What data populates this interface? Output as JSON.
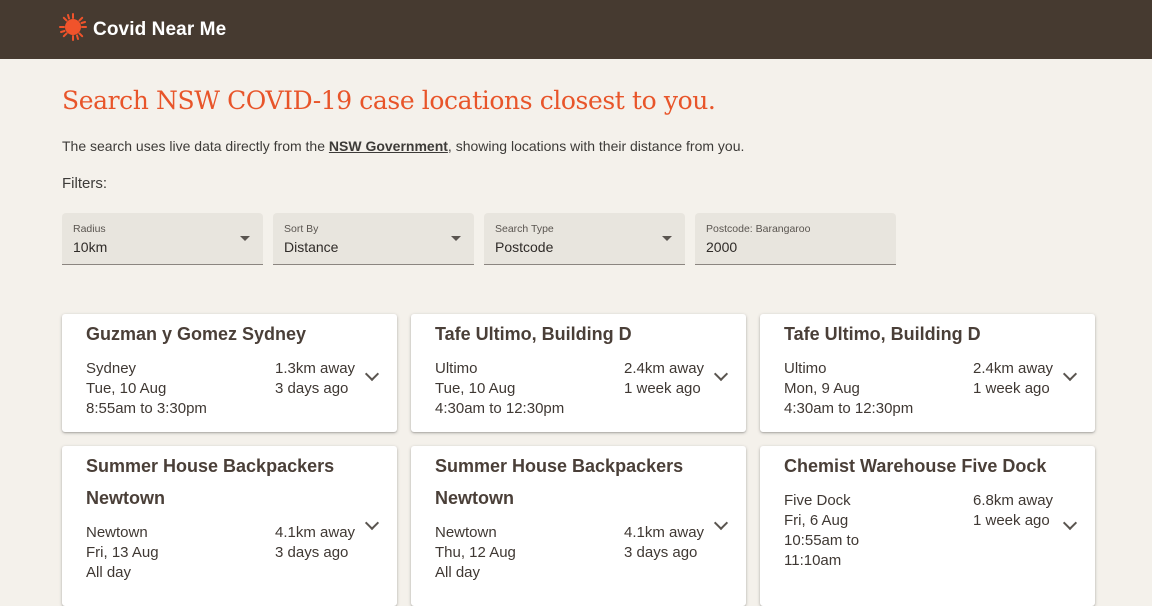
{
  "appbar": {
    "title": "Covid Near Me",
    "logo_icon": "sun-virus-icon",
    "logo_color": "#f0532b"
  },
  "headline": "Search NSW COVID-19 case locations closest to you.",
  "intro": {
    "before": "The search uses live data directly from the ",
    "link": "NSW Government",
    "after": ", showing locations with their distance from you."
  },
  "filters_label": "Filters:",
  "filters": [
    {
      "label": "Radius",
      "value": "10km",
      "has_dropdown": true
    },
    {
      "label": "Sort By",
      "value": "Distance",
      "has_dropdown": true
    },
    {
      "label": "Search Type",
      "value": "Postcode",
      "has_dropdown": true
    },
    {
      "label": "Postcode: Barangaroo",
      "value": "2000",
      "has_dropdown": false
    }
  ],
  "cards": [
    {
      "title": "Guzman y Gomez Sydney",
      "suburb": "Sydney",
      "date": "Tue, 10 Aug",
      "time": "8:55am to 3:30pm",
      "distance": "1.3km away",
      "ago": "3 days ago"
    },
    {
      "title": "Tafe Ultimo, Building D",
      "suburb": "Ultimo",
      "date": "Tue, 10 Aug",
      "time": "4:30am to 12:30pm",
      "distance": "2.4km away",
      "ago": "1 week ago"
    },
    {
      "title": "Tafe Ultimo, Building D",
      "suburb": "Ultimo",
      "date": "Mon, 9 Aug",
      "time": "4:30am to 12:30pm",
      "distance": "2.4km away",
      "ago": "1 week ago"
    },
    {
      "title": "Summer House Backpackers Newtown",
      "suburb": "Newtown",
      "date": "Fri, 13 Aug",
      "time": "All day",
      "distance": "4.1km away",
      "ago": "3 days ago"
    },
    {
      "title": "Summer House Backpackers Newtown",
      "suburb": "Newtown",
      "date": "Thu, 12 Aug",
      "time": "All day",
      "distance": "4.1km away",
      "ago": "3 days ago"
    },
    {
      "title": "Chemist Warehouse Five Dock",
      "suburb": "Five Dock",
      "date": "Fri, 6 Aug",
      "time": "10:55am to 11:10am",
      "distance": "6.8km away",
      "ago": "1 week ago"
    }
  ]
}
